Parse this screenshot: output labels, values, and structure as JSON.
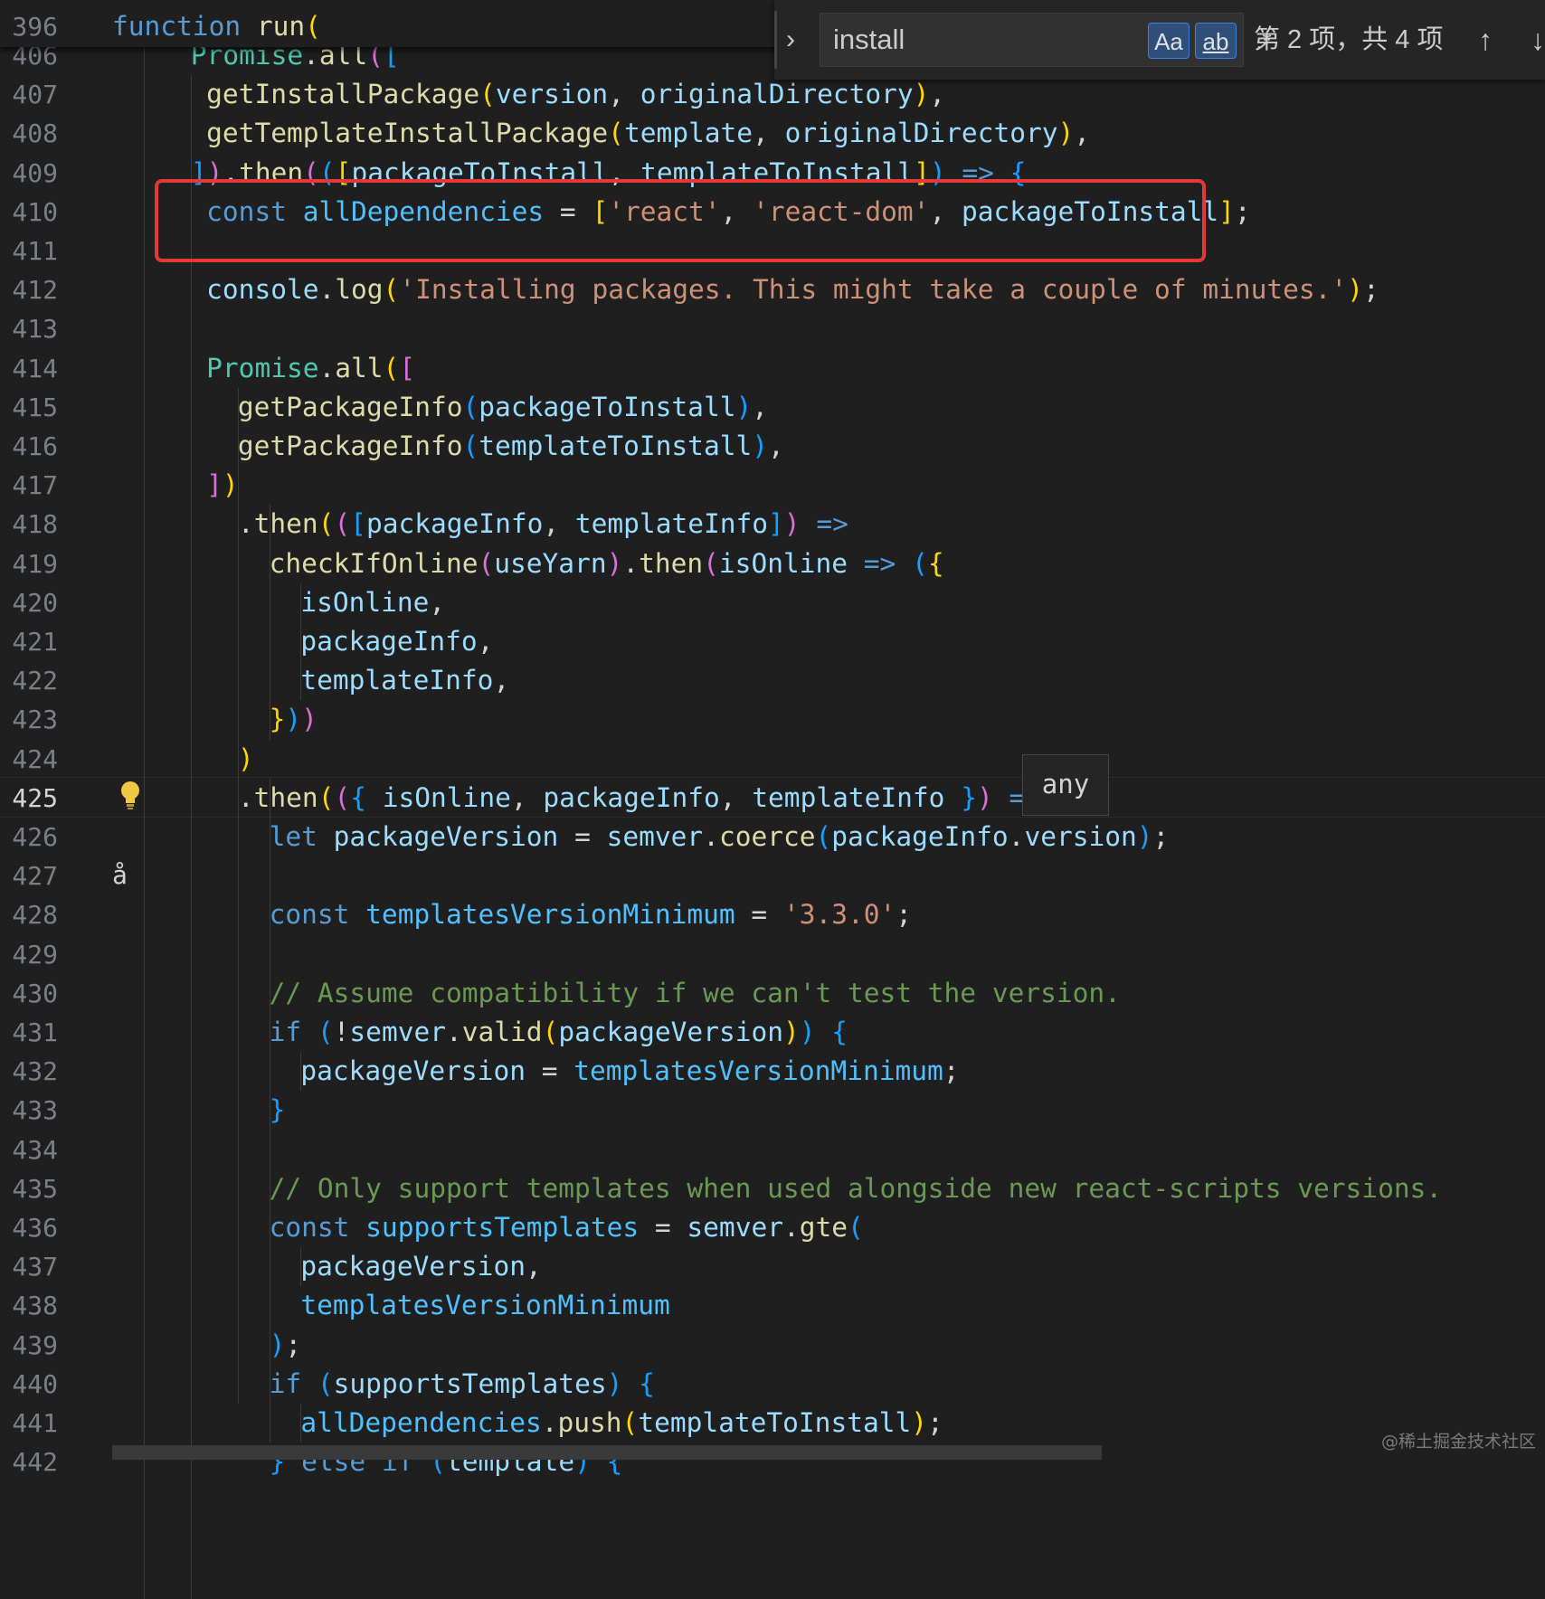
{
  "sticky": {
    "line_number": "396",
    "tokens": [
      {
        "t": "function",
        "c": "kw"
      },
      {
        "t": " ",
        "c": "op"
      },
      {
        "t": "run",
        "c": "fn"
      },
      {
        "t": "(",
        "c": "b1"
      }
    ]
  },
  "find": {
    "query": "install",
    "match_case_label": "Aa",
    "whole_word_label": "ab",
    "regex_label": ".*",
    "result_count": "第 2 项，共 4 项",
    "prev_label": "↑",
    "next_label": "↓",
    "toggle_label": "›"
  },
  "hover": {
    "text": "any"
  },
  "cursor_glyph": "å",
  "watermark": "@稀土掘金技术社区",
  "lines": [
    {
      "n": "406",
      "indent": 5,
      "tokens": [
        {
          "t": "Promise",
          "c": "cls"
        },
        {
          "t": ".",
          "c": "op"
        },
        {
          "t": "all",
          "c": "fn"
        },
        {
          "t": "(",
          "c": "b2"
        },
        {
          "t": "[",
          "c": "b3"
        }
      ]
    },
    {
      "n": "407",
      "indent": 6,
      "tokens": [
        {
          "t": "getInstallPackage",
          "c": "fn"
        },
        {
          "t": "(",
          "c": "b1"
        },
        {
          "t": "version",
          "c": "var"
        },
        {
          "t": ", ",
          "c": "op"
        },
        {
          "t": "originalDirectory",
          "c": "var"
        },
        {
          "t": ")",
          "c": "b1"
        },
        {
          "t": ",",
          "c": "op"
        }
      ]
    },
    {
      "n": "408",
      "indent": 6,
      "tokens": [
        {
          "t": "getTemplateInstallPackage",
          "c": "fn"
        },
        {
          "t": "(",
          "c": "b1"
        },
        {
          "t": "template",
          "c": "var"
        },
        {
          "t": ", ",
          "c": "op"
        },
        {
          "t": "originalDirectory",
          "c": "var"
        },
        {
          "t": ")",
          "c": "b1"
        },
        {
          "t": ",",
          "c": "op"
        }
      ]
    },
    {
      "n": "409",
      "indent": 5,
      "tokens": [
        {
          "t": "]",
          "c": "b3"
        },
        {
          "t": ")",
          "c": "b2"
        },
        {
          "t": ".",
          "c": "op"
        },
        {
          "t": "then",
          "c": "fn"
        },
        {
          "t": "(",
          "c": "b2"
        },
        {
          "t": "(",
          "c": "b3"
        },
        {
          "t": "[",
          "c": "b1"
        },
        {
          "t": "packageToInstall",
          "c": "var"
        },
        {
          "t": ", ",
          "c": "op"
        },
        {
          "t": "templateToInstall",
          "c": "var"
        },
        {
          "t": "]",
          "c": "b1"
        },
        {
          "t": ")",
          "c": "b3"
        },
        {
          "t": " ",
          "c": "op"
        },
        {
          "t": "=>",
          "c": "arrow"
        },
        {
          "t": " ",
          "c": "op"
        },
        {
          "t": "{",
          "c": "b3"
        }
      ]
    },
    {
      "n": "410",
      "indent": 6,
      "tokens": [
        {
          "t": "const",
          "c": "kw"
        },
        {
          "t": " ",
          "c": "op"
        },
        {
          "t": "allDependencies",
          "c": "const"
        },
        {
          "t": " = ",
          "c": "op"
        },
        {
          "t": "[",
          "c": "b1"
        },
        {
          "t": "'react'",
          "c": "str"
        },
        {
          "t": ", ",
          "c": "op"
        },
        {
          "t": "'react-dom'",
          "c": "str"
        },
        {
          "t": ", ",
          "c": "op"
        },
        {
          "t": "packageToInstall",
          "c": "var"
        },
        {
          "t": "]",
          "c": "b1"
        },
        {
          "t": ";",
          "c": "op"
        }
      ]
    },
    {
      "n": "411",
      "indent": 0,
      "tokens": []
    },
    {
      "n": "412",
      "indent": 6,
      "tokens": [
        {
          "t": "console",
          "c": "var"
        },
        {
          "t": ".",
          "c": "op"
        },
        {
          "t": "log",
          "c": "fn"
        },
        {
          "t": "(",
          "c": "b1"
        },
        {
          "t": "'Installing packages. This might take a couple of minutes.'",
          "c": "str"
        },
        {
          "t": ")",
          "c": "b1"
        },
        {
          "t": ";",
          "c": "op"
        }
      ]
    },
    {
      "n": "413",
      "indent": 0,
      "tokens": []
    },
    {
      "n": "414",
      "indent": 6,
      "tokens": [
        {
          "t": "Promise",
          "c": "cls"
        },
        {
          "t": ".",
          "c": "op"
        },
        {
          "t": "all",
          "c": "fn"
        },
        {
          "t": "(",
          "c": "b1"
        },
        {
          "t": "[",
          "c": "b2"
        }
      ]
    },
    {
      "n": "415",
      "indent": 8,
      "tokens": [
        {
          "t": "getPackageInfo",
          "c": "fn"
        },
        {
          "t": "(",
          "c": "b3"
        },
        {
          "t": "packageToInstall",
          "c": "var"
        },
        {
          "t": ")",
          "c": "b3"
        },
        {
          "t": ",",
          "c": "op"
        }
      ]
    },
    {
      "n": "416",
      "indent": 8,
      "tokens": [
        {
          "t": "getPackageInfo",
          "c": "fn"
        },
        {
          "t": "(",
          "c": "b3"
        },
        {
          "t": "templateToInstall",
          "c": "var"
        },
        {
          "t": ")",
          "c": "b3"
        },
        {
          "t": ",",
          "c": "op"
        }
      ]
    },
    {
      "n": "417",
      "indent": 6,
      "tokens": [
        {
          "t": "]",
          "c": "b2"
        },
        {
          "t": ")",
          "c": "b1"
        }
      ]
    },
    {
      "n": "418",
      "indent": 8,
      "tokens": [
        {
          "t": ".",
          "c": "op"
        },
        {
          "t": "then",
          "c": "fn"
        },
        {
          "t": "(",
          "c": "b1"
        },
        {
          "t": "(",
          "c": "b2"
        },
        {
          "t": "[",
          "c": "b3"
        },
        {
          "t": "packageInfo",
          "c": "var"
        },
        {
          "t": ", ",
          "c": "op"
        },
        {
          "t": "templateInfo",
          "c": "var"
        },
        {
          "t": "]",
          "c": "b3"
        },
        {
          "t": ")",
          "c": "b2"
        },
        {
          "t": " ",
          "c": "op"
        },
        {
          "t": "=>",
          "c": "arrow"
        }
      ]
    },
    {
      "n": "419",
      "indent": 10,
      "tokens": [
        {
          "t": "checkIfOnline",
          "c": "fn"
        },
        {
          "t": "(",
          "c": "b2"
        },
        {
          "t": "useYarn",
          "c": "var"
        },
        {
          "t": ")",
          "c": "b2"
        },
        {
          "t": ".",
          "c": "op"
        },
        {
          "t": "then",
          "c": "fn"
        },
        {
          "t": "(",
          "c": "b2"
        },
        {
          "t": "isOnline",
          "c": "var"
        },
        {
          "t": " ",
          "c": "op"
        },
        {
          "t": "=>",
          "c": "arrow"
        },
        {
          "t": " ",
          "c": "op"
        },
        {
          "t": "(",
          "c": "b3"
        },
        {
          "t": "{",
          "c": "b1"
        }
      ]
    },
    {
      "n": "420",
      "indent": 12,
      "tokens": [
        {
          "t": "isOnline",
          "c": "var"
        },
        {
          "t": ",",
          "c": "op"
        }
      ]
    },
    {
      "n": "421",
      "indent": 12,
      "tokens": [
        {
          "t": "packageInfo",
          "c": "var"
        },
        {
          "t": ",",
          "c": "op"
        }
      ]
    },
    {
      "n": "422",
      "indent": 12,
      "tokens": [
        {
          "t": "templateInfo",
          "c": "var"
        },
        {
          "t": ",",
          "c": "op"
        }
      ]
    },
    {
      "n": "423",
      "indent": 10,
      "tokens": [
        {
          "t": "}",
          "c": "b1"
        },
        {
          "t": ")",
          "c": "b3"
        },
        {
          "t": ")",
          "c": "b2"
        }
      ]
    },
    {
      "n": "424",
      "indent": 8,
      "tokens": [
        {
          "t": ")",
          "c": "b1"
        }
      ]
    },
    {
      "n": "425",
      "indent": 8,
      "active": true,
      "tokens": [
        {
          "t": ".",
          "c": "op"
        },
        {
          "t": "then",
          "c": "fn"
        },
        {
          "t": "(",
          "c": "b1"
        },
        {
          "t": "(",
          "c": "b2"
        },
        {
          "t": "{",
          "c": "b3"
        },
        {
          "t": " ",
          "c": "op"
        },
        {
          "t": "isOnline",
          "c": "var"
        },
        {
          "t": ", ",
          "c": "op"
        },
        {
          "t": "packageInfo",
          "c": "var"
        },
        {
          "t": ", ",
          "c": "op"
        },
        {
          "t": "templateInfo",
          "c": "var"
        },
        {
          "t": " ",
          "c": "op"
        },
        {
          "t": "}",
          "c": "b3"
        },
        {
          "t": ")",
          "c": "b2"
        },
        {
          "t": " ",
          "c": "op"
        },
        {
          "t": "=>",
          "c": "arrow"
        },
        {
          "t": " ",
          "c": "op"
        },
        {
          "t": "{",
          "c": "b2"
        }
      ]
    },
    {
      "n": "426",
      "indent": 10,
      "tokens": [
        {
          "t": "let",
          "c": "kw"
        },
        {
          "t": " ",
          "c": "op"
        },
        {
          "t": "packageVersion",
          "c": "var"
        },
        {
          "t": " = ",
          "c": "op"
        },
        {
          "t": "semver",
          "c": "var"
        },
        {
          "t": ".",
          "c": "op"
        },
        {
          "t": "coerce",
          "c": "fn"
        },
        {
          "t": "(",
          "c": "b3"
        },
        {
          "t": "packageInfo",
          "c": "var"
        },
        {
          "t": ".",
          "c": "op"
        },
        {
          "t": "version",
          "c": "var"
        },
        {
          "t": ")",
          "c": "b3"
        },
        {
          "t": ";",
          "c": "op"
        }
      ]
    },
    {
      "n": "427",
      "indent": 0,
      "tokens": []
    },
    {
      "n": "428",
      "indent": 10,
      "tokens": [
        {
          "t": "const",
          "c": "kw"
        },
        {
          "t": " ",
          "c": "op"
        },
        {
          "t": "templatesVersionMinimum",
          "c": "const"
        },
        {
          "t": " = ",
          "c": "op"
        },
        {
          "t": "'3.3.0'",
          "c": "str"
        },
        {
          "t": ";",
          "c": "op"
        }
      ]
    },
    {
      "n": "429",
      "indent": 0,
      "tokens": []
    },
    {
      "n": "430",
      "indent": 10,
      "tokens": [
        {
          "t": "// Assume compatibility if we can't test the version.",
          "c": "cm"
        }
      ]
    },
    {
      "n": "431",
      "indent": 10,
      "tokens": [
        {
          "t": "if",
          "c": "kw"
        },
        {
          "t": " ",
          "c": "op"
        },
        {
          "t": "(",
          "c": "b3"
        },
        {
          "t": "!",
          "c": "op"
        },
        {
          "t": "semver",
          "c": "var"
        },
        {
          "t": ".",
          "c": "op"
        },
        {
          "t": "valid",
          "c": "fn"
        },
        {
          "t": "(",
          "c": "b1"
        },
        {
          "t": "packageVersion",
          "c": "var"
        },
        {
          "t": ")",
          "c": "b1"
        },
        {
          "t": ")",
          "c": "b3"
        },
        {
          "t": " ",
          "c": "op"
        },
        {
          "t": "{",
          "c": "b3"
        }
      ]
    },
    {
      "n": "432",
      "indent": 12,
      "tokens": [
        {
          "t": "packageVersion",
          "c": "var"
        },
        {
          "t": " = ",
          "c": "op"
        },
        {
          "t": "templatesVersionMinimum",
          "c": "const"
        },
        {
          "t": ";",
          "c": "op"
        }
      ]
    },
    {
      "n": "433",
      "indent": 10,
      "tokens": [
        {
          "t": "}",
          "c": "b3"
        }
      ]
    },
    {
      "n": "434",
      "indent": 0,
      "tokens": []
    },
    {
      "n": "435",
      "indent": 10,
      "tokens": [
        {
          "t": "// Only support templates when used alongside new react-scripts versions.",
          "c": "cm"
        }
      ]
    },
    {
      "n": "436",
      "indent": 10,
      "tokens": [
        {
          "t": "const",
          "c": "kw"
        },
        {
          "t": " ",
          "c": "op"
        },
        {
          "t": "supportsTemplates",
          "c": "const"
        },
        {
          "t": " = ",
          "c": "op"
        },
        {
          "t": "semver",
          "c": "var"
        },
        {
          "t": ".",
          "c": "op"
        },
        {
          "t": "gte",
          "c": "fn"
        },
        {
          "t": "(",
          "c": "b3"
        }
      ]
    },
    {
      "n": "437",
      "indent": 12,
      "tokens": [
        {
          "t": "packageVersion",
          "c": "var"
        },
        {
          "t": ",",
          "c": "op"
        }
      ]
    },
    {
      "n": "438",
      "indent": 12,
      "tokens": [
        {
          "t": "templatesVersionMinimum",
          "c": "const"
        }
      ]
    },
    {
      "n": "439",
      "indent": 10,
      "tokens": [
        {
          "t": ")",
          "c": "b3"
        },
        {
          "t": ";",
          "c": "op"
        }
      ]
    },
    {
      "n": "440",
      "indent": 10,
      "tokens": [
        {
          "t": "if",
          "c": "kw"
        },
        {
          "t": " ",
          "c": "op"
        },
        {
          "t": "(",
          "c": "b3"
        },
        {
          "t": "supportsTemplates",
          "c": "var"
        },
        {
          "t": ")",
          "c": "b3"
        },
        {
          "t": " ",
          "c": "op"
        },
        {
          "t": "{",
          "c": "b3"
        }
      ]
    },
    {
      "n": "441",
      "indent": 12,
      "tokens": [
        {
          "t": "allDependencies",
          "c": "const"
        },
        {
          "t": ".",
          "c": "op"
        },
        {
          "t": "push",
          "c": "fn"
        },
        {
          "t": "(",
          "c": "b1"
        },
        {
          "t": "templateToInstall",
          "c": "var"
        },
        {
          "t": ")",
          "c": "b1"
        },
        {
          "t": ";",
          "c": "op"
        }
      ]
    },
    {
      "n": "442",
      "indent": 10,
      "tokens": [
        {
          "t": "}",
          "c": "b3"
        },
        {
          "t": " ",
          "c": "op"
        },
        {
          "t": "else",
          "c": "kw"
        },
        {
          "t": " ",
          "c": "op"
        },
        {
          "t": "if",
          "c": "kw"
        },
        {
          "t": " ",
          "c": "op"
        },
        {
          "t": "(",
          "c": "b3"
        },
        {
          "t": "template",
          "c": "var"
        },
        {
          "t": ")",
          "c": "b3"
        },
        {
          "t": " ",
          "c": "op"
        },
        {
          "t": "{",
          "c": "b3"
        }
      ]
    }
  ]
}
